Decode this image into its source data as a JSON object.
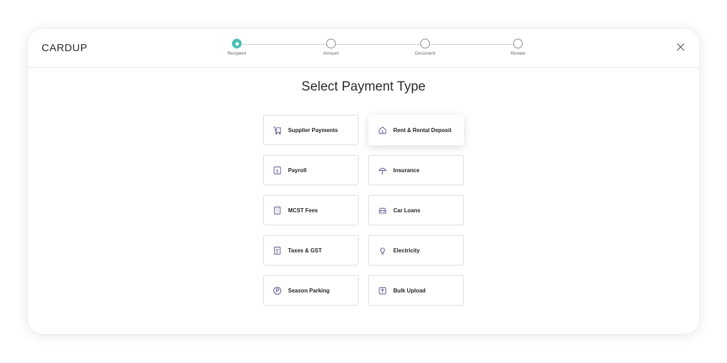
{
  "app": {
    "logo": "CARDUP"
  },
  "stepper": {
    "steps": [
      {
        "label": "Recipient",
        "state": "active"
      },
      {
        "label": "Amount",
        "state": "pending"
      },
      {
        "label": "Document",
        "state": "pending"
      },
      {
        "label": "Review",
        "state": "pending"
      }
    ]
  },
  "main": {
    "title": "Select Payment Type"
  },
  "payment_types": [
    {
      "label": "Supplier Payments",
      "icon": "trolley-icon",
      "selected": false
    },
    {
      "label": "Rent & Rental Deposit",
      "icon": "house-dollar-icon",
      "selected": true
    },
    {
      "label": "Payroll",
      "icon": "payslip-icon",
      "selected": false
    },
    {
      "label": "Insurance",
      "icon": "umbrella-icon",
      "selected": false
    },
    {
      "label": "MCST Fees",
      "icon": "building-icon",
      "selected": false
    },
    {
      "label": "Car Loans",
      "icon": "car-icon",
      "selected": false
    },
    {
      "label": "Taxes & GST",
      "icon": "document-icon",
      "selected": false
    },
    {
      "label": "Electricity",
      "icon": "lightbulb-icon",
      "selected": false
    },
    {
      "label": "Season Parking",
      "icon": "parking-icon",
      "selected": false
    },
    {
      "label": "Bulk Upload",
      "icon": "upload-icon",
      "selected": false
    }
  ],
  "colors": {
    "accent": "#4dbfb7",
    "icon": "#5a4a8a",
    "border": "#dedede"
  }
}
